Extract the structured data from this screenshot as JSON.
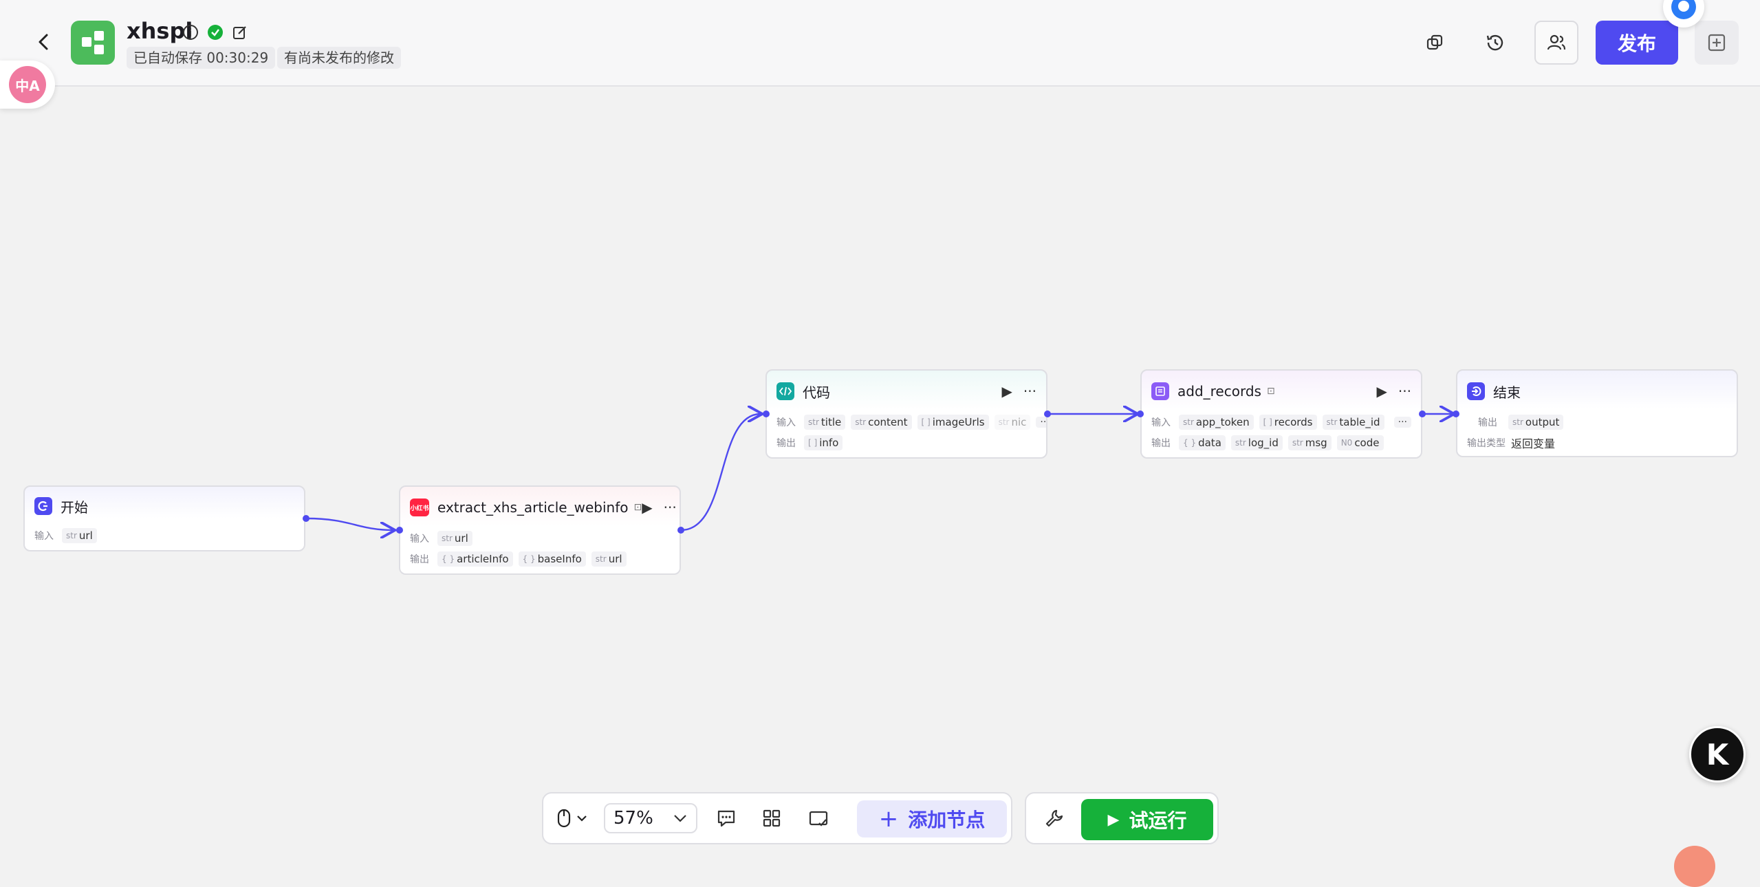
{
  "header": {
    "app_name": "xhspl",
    "autosave": "已自动保存 00:30:29",
    "unpublished": "有尚未发布的修改",
    "publish_label": "发布"
  },
  "translate_bubble": {
    "label": "中A"
  },
  "nodes": {
    "start": {
      "title": "开始",
      "input_label": "输入",
      "inputs": [
        {
          "type": "str",
          "name": "url"
        }
      ]
    },
    "extract": {
      "title": "extract_xhs_article_webinfo",
      "icon_text": "小红书",
      "input_label": "输入",
      "output_label": "输出",
      "inputs": [
        {
          "type": "str",
          "name": "url"
        }
      ],
      "outputs": [
        {
          "type": "{ }",
          "name": "articleInfo"
        },
        {
          "type": "{ }",
          "name": "baseInfo"
        },
        {
          "type": "str",
          "name": "url"
        }
      ]
    },
    "code": {
      "title": "代码",
      "input_label": "输入",
      "output_label": "输出",
      "more": "···",
      "inputs": [
        {
          "type": "str",
          "name": "title"
        },
        {
          "type": "str",
          "name": "content"
        },
        {
          "type": "[ ]",
          "name": "imageUrls"
        },
        {
          "type": "str",
          "name": "nic"
        }
      ],
      "outputs": [
        {
          "type": "[ ]",
          "name": "info"
        }
      ]
    },
    "add_records": {
      "title": "add_records",
      "input_label": "输入",
      "output_label": "输出",
      "more": "···",
      "inputs": [
        {
          "type": "str",
          "name": "app_token"
        },
        {
          "type": "[ ]",
          "name": "records"
        },
        {
          "type": "str",
          "name": "table_id"
        }
      ],
      "outputs": [
        {
          "type": "{ }",
          "name": "data"
        },
        {
          "type": "str",
          "name": "log_id"
        },
        {
          "type": "str",
          "name": "msg"
        },
        {
          "type": "N0",
          "name": "code"
        }
      ]
    },
    "end": {
      "title": "结束",
      "output_label": "输出",
      "output_type_label": "输出类型",
      "output_type_value": "返回变量",
      "outputs": [
        {
          "type": "str",
          "name": "output"
        }
      ]
    }
  },
  "toolbar": {
    "zoom": "57%",
    "add_node_label": "添加节点",
    "run_label": "试运行"
  },
  "avatar": {
    "letter": "K"
  },
  "colors": {
    "accent": "#4f4af0",
    "run_green": "#16b13a",
    "logo_green": "#4cbb5b"
  }
}
